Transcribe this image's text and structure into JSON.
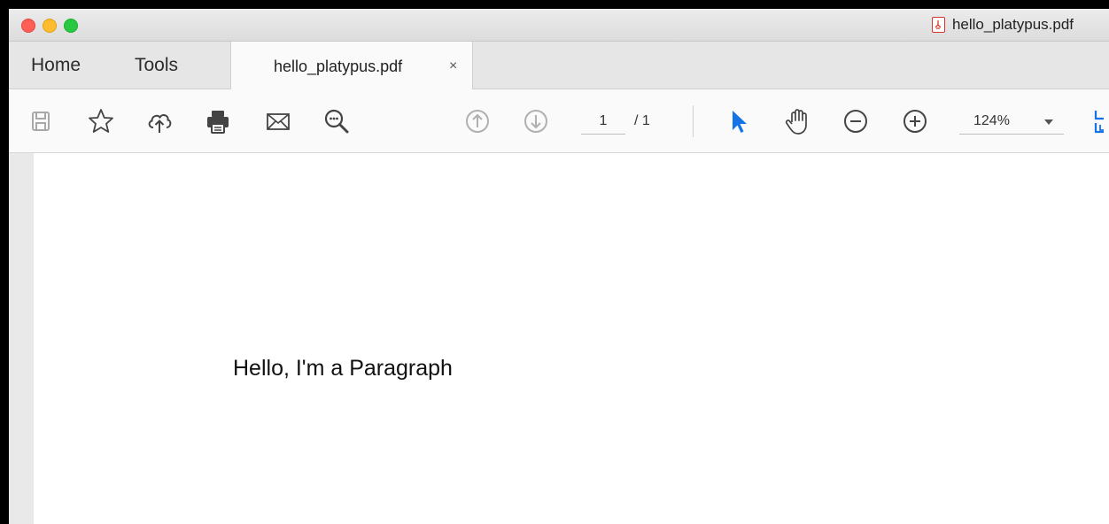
{
  "window": {
    "title": "hello_platypus.pdf",
    "title_icon": "pdf-file-icon"
  },
  "nav_tabs": [
    {
      "label": "Home"
    },
    {
      "label": "Tools"
    }
  ],
  "document_tab": {
    "label": "hello_platypus.pdf",
    "close_glyph": "×"
  },
  "toolbar": {
    "icons": [
      "save-icon",
      "bookmark-star-icon",
      "cloud-upload-icon",
      "print-icon",
      "email-icon",
      "find-icon",
      "previous-page-icon",
      "next-page-icon",
      "select-tool-icon",
      "hand-tool-icon",
      "zoom-out-icon",
      "zoom-in-icon",
      "fit-page-icon"
    ],
    "page_current": "1",
    "page_total": "/ 1",
    "zoom_value": "124%"
  },
  "document": {
    "paragraph": "Hello, I'm a Paragraph"
  },
  "colors": {
    "accent": "#1473e6",
    "close": "#fe5f57",
    "minimize": "#febc2e",
    "maximize": "#28c840",
    "pdf_red": "#d8352a"
  }
}
